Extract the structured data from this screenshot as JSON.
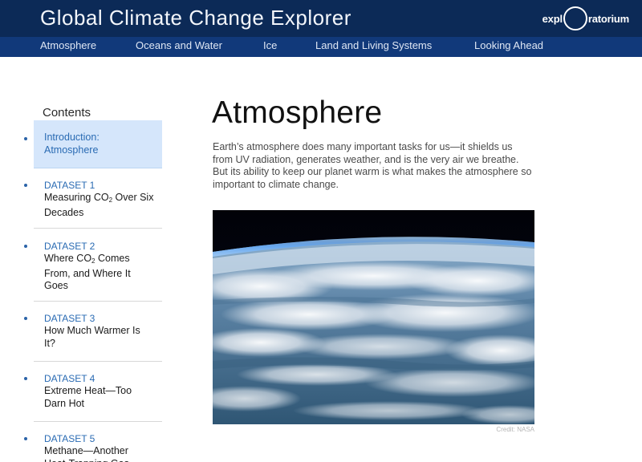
{
  "header": {
    "site_title": "Global Climate Change Explorer",
    "brand_left": "expl",
    "brand_right": "ratorium"
  },
  "nav": {
    "items": [
      {
        "label": "Atmosphere"
      },
      {
        "label": "Oceans and Water"
      },
      {
        "label": "Ice"
      },
      {
        "label": "Land and Living Systems"
      },
      {
        "label": "Looking Ahead"
      }
    ]
  },
  "sidebar": {
    "contents_label": "Contents",
    "items": [
      {
        "title": "Introduction: Atmosphere"
      },
      {
        "dataset": "DATASET 1",
        "title_a": "Measuring CO",
        "title_sub": "2",
        "title_b": " Over Six Decades"
      },
      {
        "dataset": "DATASET 2",
        "title_a": "Where CO",
        "title_sub": "2",
        "title_b": " Comes From, and Where It Goes"
      },
      {
        "dataset": "DATASET 3",
        "title": "How Much Warmer Is It?"
      },
      {
        "dataset": "DATASET 4",
        "title": "Extreme Heat—Too Darn Hot"
      },
      {
        "dataset": "DATASET 5",
        "title": "Methane—Another Heat-Trapping Gas"
      }
    ]
  },
  "main": {
    "title": "Atmosphere",
    "intro": "Earth’s atmosphere does many important tasks for us—it shields us from UV radiation, generates weather, and is the very air we breathe. But its ability to keep our planet warm is what makes the atmosphere so important to climate change.",
    "image_credit": "Credit: NASA"
  },
  "colors": {
    "header_bg": "#0c2a57",
    "nav_bg": "#11397a",
    "link_blue": "#2a6bb3",
    "active_bg": "#d5e6fb"
  }
}
